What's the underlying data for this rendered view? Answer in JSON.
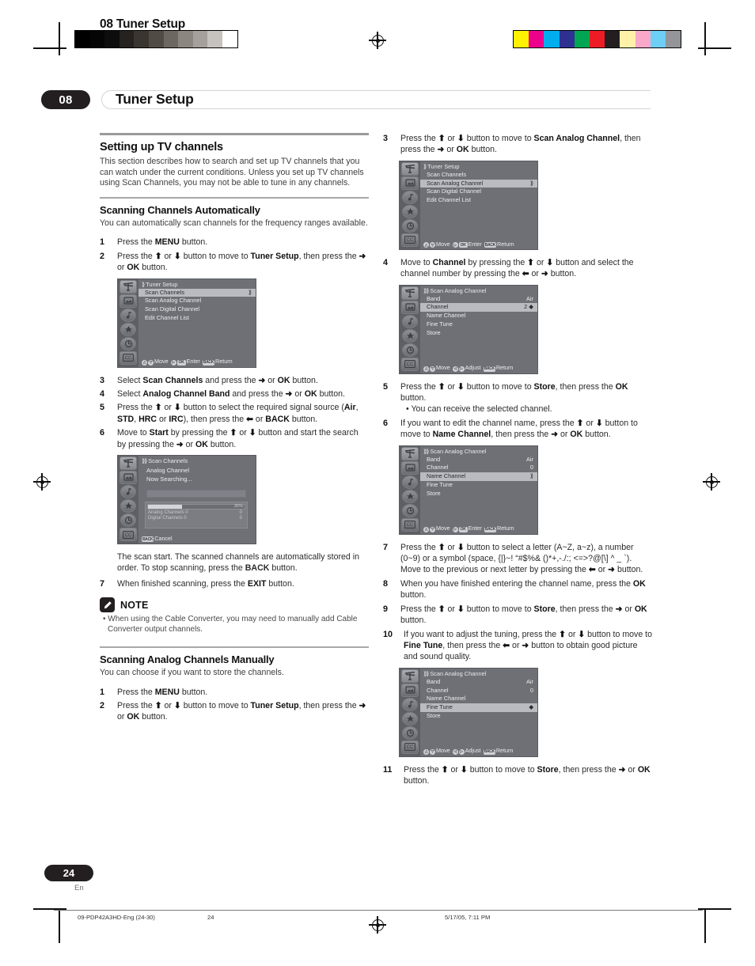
{
  "header": {
    "kicker": "08 Tuner Setup",
    "chapter_number": "08",
    "chapter_title": "Tuner Setup"
  },
  "gray_bar_colors": [
    "#000000",
    "#050505",
    "#0d0d0d",
    "#252220",
    "#3a3531",
    "#514b46",
    "#6d6762",
    "#8b8680",
    "#a5a09b",
    "#c6c3bf",
    "#ffffff"
  ],
  "color_bar_colors": [
    "#fff200",
    "#ec008c",
    "#00aeef",
    "#2e3192",
    "#00a651",
    "#ed1c24",
    "#231f20",
    "#fff1a8",
    "#f9a8c9",
    "#6dcff6",
    "#939598"
  ],
  "left_column": {
    "section_title": "Setting up TV channels",
    "intro": "This section describes how to search and set up TV channels that you can watch under the current conditions. Unless you set up TV channels using Scan Channels, you may not be able to tune in any channels.",
    "sub1_title": "Scanning Channels Automatically",
    "sub1_intro": "You can automatically scan channels for the frequency ranges available.",
    "steps_a": [
      {
        "num": "1",
        "html": "Press the <b>MENU</b> button."
      },
      {
        "num": "2",
        "html": "Press the <b>⬆</b> or <b>⬇</b> button to move to <b>Tuner Setup</b>, then press the <b>➜</b> or <b>OK</b> button."
      }
    ],
    "steps_b": [
      {
        "num": "3",
        "html": "Select <b>Scan Channels</b> and press the <b>➜</b> or <b>OK</b> button."
      },
      {
        "num": "4",
        "html": "Select <b>Analog Channel Band</b> and press the <b>➜</b> or <b>OK</b> button."
      },
      {
        "num": "5",
        "html": "Press the <b>⬆</b> or <b>⬇</b> button to select the required signal source (<b>Air</b>, <b>STD</b>, <b>HRC</b> or <b>IRC</b>), then press the <b>⬅</b> or <b>BACK</b> button."
      },
      {
        "num": "6",
        "html": "Move to <b>Start</b> by pressing the <b>⬆</b> or <b>⬇</b> button and start the search by pressing the <b>➜</b> or <b>OK</b> button."
      }
    ],
    "scan_note": "The scan start. The scanned channels are automatically stored in order. To stop scanning, press the <b>BACK</b> button.",
    "steps_c": [
      {
        "num": "7",
        "html": "When finished scanning, press the <b>EXIT</b> button."
      }
    ],
    "note": {
      "title": "NOTE",
      "bullet": "• When using the Cable Converter, you may need to manually add Cable Converter output channels."
    },
    "sub2_title": "Scanning Analog Channels Manually",
    "sub2_intro": "You can choose if you want to store the channels.",
    "steps_d": [
      {
        "num": "1",
        "html": "Press the <b>MENU</b> button."
      },
      {
        "num": "2",
        "html": "Press the <b>⬆</b> or <b>⬇</b> button to move to <b>Tuner Setup</b>, then press the <b>➜</b> or <b>OK</b> button."
      }
    ]
  },
  "right_column": {
    "steps_a": [
      {
        "num": "3",
        "html": "Press the <b>⬆</b> or <b>⬇</b> button to move to <b>Scan Analog Channel</b>, then press the <b>➜</b> or <b>OK</b> button."
      }
    ],
    "steps_b": [
      {
        "num": "4",
        "html": "Move to <b>Channel</b> by pressing the <b>⬆</b> or <b>⬇</b> button and select the channel number by pressing the <b>⬅</b> or <b>➜</b> button."
      }
    ],
    "steps_c": [
      {
        "num": "5",
        "html": "Press the <b>⬆</b> or <b>⬇</b> button to move to <b>Store</b>, then press the <b>OK</b> button.<span class=\"sub-bullet\">• You can receive the selected channel.</span>"
      },
      {
        "num": "6",
        "html": "If you want to edit the channel name, press the <b>⬆</b> or <b>⬇</b> button to move to <b>Name Channel</b>, then press the <b>➜</b> or <b>OK</b> button."
      }
    ],
    "steps_d": [
      {
        "num": "7",
        "html": "Press the <b>⬆</b> or <b>⬇</b> button to select a letter (A~Z, a~z), a number (0~9) or a symbol (space, {|}~! “#$%&amp; ()*+,-./:; &lt;=&gt;?@[\\] ^ _ `). Move to the previous or next letter by pressing the <b>⬅</b> or <b>➜</b> button."
      },
      {
        "num": "8",
        "html": "When you have finished entering the channel name, press the <b>OK</b> button."
      },
      {
        "num": "9",
        "html": "Press the <b>⬆</b> or <b>⬇</b> button to move to <b>Store</b>, then press the <b>➜</b> or <b>OK</b> button."
      },
      {
        "num": "10",
        "html": "If you want to adjust the tuning, press the <b>⬆</b> or <b>⬇</b> button to move to <b>Fine Tune</b>, then press the <b>⬅</b> or <b>➜</b> button to obtain good picture and sound quality."
      }
    ],
    "steps_e": [
      {
        "num": "11",
        "html": "Press the <b>⬆</b> or <b>⬇</b> button to move to <b>Store</b>, then press the <b>➜</b> or <b>OK</b> button."
      }
    ]
  },
  "osd_screens": {
    "tuner_setup_scan_channels": {
      "title": "Tuner Setup",
      "rows": [
        {
          "label": "Scan Channels",
          "value": "⟫",
          "selected": true
        },
        {
          "label": "Scan Analog Channel",
          "value": "",
          "selected": false
        },
        {
          "label": "Scan Digital Channel",
          "value": "",
          "selected": false
        },
        {
          "label": "Edit Channel List",
          "value": "",
          "selected": false
        }
      ],
      "footer": [
        {
          "keys": [
            "△",
            "▽"
          ],
          "label": "Move"
        },
        {
          "keys": [
            "▷",
            "OK"
          ],
          "label": "Enter"
        },
        {
          "keys": [
            "BACK"
          ],
          "label": "Return"
        }
      ]
    },
    "scan_channels_searching": {
      "title": "Scan Channels",
      "line1": "Analog Channel",
      "line2": "Now Searching...",
      "progress_percent": "35%",
      "progress_value": 35,
      "counters": [
        {
          "label": "Analog Channels 0",
          "value": "0"
        },
        {
          "label": "Digital Channels 0",
          "value": "0"
        }
      ],
      "footer": [
        {
          "keys": [
            "BACK"
          ],
          "label": "Cancel"
        }
      ]
    },
    "tuner_setup_scan_analog": {
      "title": "Tuner Setup",
      "rows": [
        {
          "label": "Scan Channels",
          "value": "",
          "selected": false
        },
        {
          "label": "Scan Analog Channel",
          "value": "⟫",
          "selected": true
        },
        {
          "label": "Scan Digital Channel",
          "value": "",
          "selected": false
        },
        {
          "label": "Edit Channel List",
          "value": "",
          "selected": false
        }
      ],
      "footer": [
        {
          "keys": [
            "△",
            "▽"
          ],
          "label": "Move"
        },
        {
          "keys": [
            "▷",
            "OK"
          ],
          "label": "Enter"
        },
        {
          "keys": [
            "BACK"
          ],
          "label": "Return"
        }
      ]
    },
    "scan_analog_channel_channel": {
      "title": "Scan Analog Channel",
      "rows": [
        {
          "label": "Band",
          "value": "Air",
          "selected": false
        },
        {
          "label": "Channel",
          "value": "2 ◆",
          "selected": true
        },
        {
          "label": "Name Channel",
          "value": "",
          "selected": false
        },
        {
          "label": "Fine Tune",
          "value": "",
          "selected": false
        },
        {
          "label": "Store",
          "value": "",
          "selected": false
        }
      ],
      "footer": [
        {
          "keys": [
            "△",
            "▽"
          ],
          "label": "Move"
        },
        {
          "keys": [
            "◁",
            "▷"
          ],
          "label": "Adjust"
        },
        {
          "keys": [
            "BACK"
          ],
          "label": "Return"
        }
      ]
    },
    "scan_analog_channel_name": {
      "title": "Scan Analog Channel",
      "rows": [
        {
          "label": "Band",
          "value": "Air",
          "selected": false
        },
        {
          "label": "Channel",
          "value": "0",
          "selected": false
        },
        {
          "label": "Name Channel",
          "value": "⟫",
          "selected": true
        },
        {
          "label": "Fine Tune",
          "value": "",
          "selected": false
        },
        {
          "label": "Store",
          "value": "",
          "selected": false
        }
      ],
      "footer": [
        {
          "keys": [
            "△",
            "▽"
          ],
          "label": "Move"
        },
        {
          "keys": [
            "▷",
            "OK"
          ],
          "label": "Enter"
        },
        {
          "keys": [
            "BACK"
          ],
          "label": "Return"
        }
      ]
    },
    "scan_analog_channel_fine_tune": {
      "title": "Scan Analog Channel",
      "rows": [
        {
          "label": "Band",
          "value": "Air",
          "selected": false
        },
        {
          "label": "Channel",
          "value": "0",
          "selected": false
        },
        {
          "label": "Name Channel",
          "value": "",
          "selected": false
        },
        {
          "label": "Fine Tune",
          "value": "◆",
          "selected": true
        },
        {
          "label": "Store",
          "value": "",
          "selected": false
        }
      ],
      "footer": [
        {
          "keys": [
            "△",
            "▽"
          ],
          "label": "Move"
        },
        {
          "keys": [
            "◁",
            "▷"
          ],
          "label": "Adjust"
        },
        {
          "keys": [
            "BACK"
          ],
          "label": "Return"
        }
      ]
    }
  },
  "footer": {
    "page_number": "24",
    "language": "En",
    "file_name": "09-PDP42A3HD-Eng (24-30)",
    "folio": "24",
    "timestamp": "5/17/05, 7:11 PM"
  }
}
